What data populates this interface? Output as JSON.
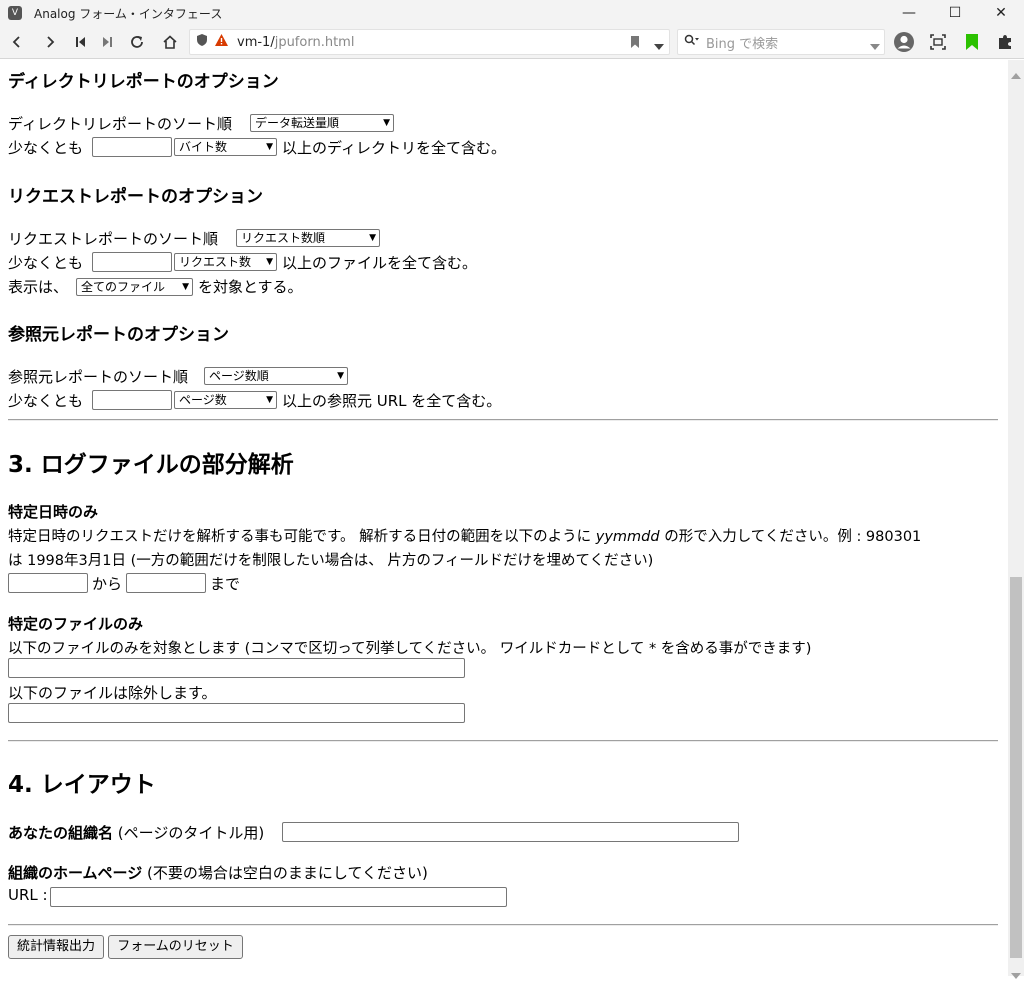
{
  "window": {
    "title": "Analog フォーム・インタフェース",
    "minimize_glyph": "—",
    "maximize_glyph": "☐",
    "close_glyph": "✕"
  },
  "toolbar": {
    "url_host": "vm-1/",
    "url_path": "jpuforn.html",
    "search_placeholder": "Bing で検索"
  },
  "icons": {
    "back": "back-icon",
    "forward": "forward-icon",
    "first": "first-page-icon",
    "last": "last-page-icon",
    "reload": "reload-icon",
    "home": "home-icon",
    "shield": "shield-icon",
    "warning": "warning-icon",
    "bookmark": "bookmark-icon",
    "search": "search-icon",
    "profile": "profile-icon",
    "screenshot": "screenshot-icon",
    "extensions": "extensions-icon",
    "puzzle": "puzzle-icon"
  },
  "colors": {
    "accent_green": "#2bc100",
    "warning_red": "#d83b01"
  },
  "directory_options": {
    "heading": "ディレクトリレポートのオプション",
    "sort_label": "ディレクトリレポートのソート順",
    "sort_value": "データ転送量順",
    "min_prefix": "少なくとも",
    "min_unit_value": "バイト数",
    "min_suffix": "以上のディレクトリを全て含む。"
  },
  "request_options": {
    "heading": "リクエストレポートのオプション",
    "sort_label": "リクエストレポートのソート順",
    "sort_value": "リクエスト数順",
    "min_prefix": "少なくとも",
    "min_unit_value": "リクエスト数",
    "min_suffix": "以上のファイルを全て含む。",
    "show_prefix": "表示は、",
    "show_value": "全てのファイル",
    "show_suffix": "を対象とする。"
  },
  "referrer_options": {
    "heading": "参照元レポートのオプション",
    "sort_label": "参照元レポートのソート順",
    "sort_value": "ページ数順",
    "min_prefix": "少なくとも",
    "min_unit_value": "ページ数",
    "min_suffix": "以上の参照元 URL を全て含む。"
  },
  "partial_analysis": {
    "heading": "3. ログファイルの部分解析",
    "date_heading": "特定日時のみ",
    "date_desc_1": "特定日時のリクエストだけを解析する事も可能です。 解析する日付の範囲を以下のように",
    "date_desc_fmt": "yymmdd",
    "date_desc_2": "の形で入力してください。例 : 980301",
    "date_desc_3": "は 1998年3月1日 (一方の範囲だけを制限したい場合は、 片方のフィールドだけを埋めてください)",
    "from_label": "から",
    "to_label": "まで",
    "file_heading": "特定のファイルのみ",
    "include_label": "以下のファイルのみを対象とします (コンマで区切って列挙してください。 ワイルドカードとして * を含める事ができます)",
    "exclude_label": "以下のファイルは除外します。"
  },
  "layout": {
    "heading": "4. レイアウト",
    "org_label_bold": "あなたの組織名",
    "org_label_rest": "(ページのタイトル用)",
    "home_label_bold": "組織のホームページ",
    "home_label_rest": "(不要の場合は空白のままにしてください)",
    "url_label": "URL :"
  },
  "buttons": {
    "submit": "統計情報出力",
    "reset": "フォームのリセット"
  }
}
